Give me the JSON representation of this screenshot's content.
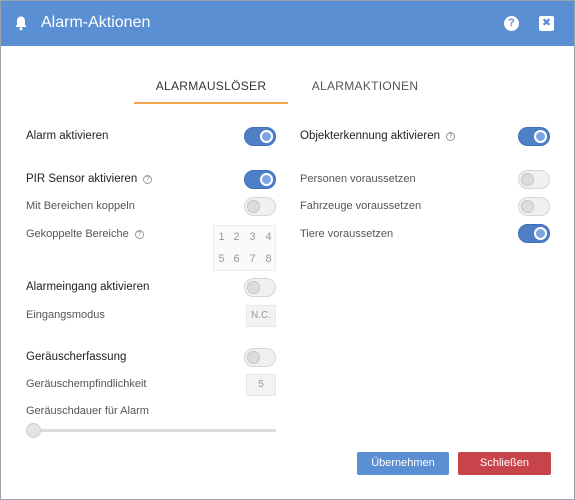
{
  "dialog": {
    "title": "Alarm-Aktionen",
    "icons": {
      "title": "bell-icon",
      "help": "help-icon",
      "close": "close-icon"
    },
    "help_glyph": "?",
    "close_glyph": "✖"
  },
  "tabs": [
    {
      "label": "ALARMAUSLÖSER",
      "active": true
    },
    {
      "label": "ALARMAKTIONEN",
      "active": false
    }
  ],
  "left": {
    "alarm_enable": {
      "label": "Alarm aktivieren",
      "on": true
    },
    "pir_enable": {
      "label": "PIR Sensor aktivieren",
      "on": true
    },
    "link_zones": {
      "label": "Mit Bereichen koppeln",
      "on": false
    },
    "linked_zones": {
      "label": "Gekoppelte Bereiche",
      "cells": [
        "1",
        "2",
        "3",
        "4",
        "5",
        "6",
        "7",
        "8"
      ]
    },
    "alarm_input": {
      "label": "Alarmeingang aktivieren",
      "on": false
    },
    "input_mode": {
      "label": "Eingangsmodus",
      "value": "N.C."
    },
    "noise_detect": {
      "label": "Geräuscherfassung",
      "on": false
    },
    "noise_sensitivity": {
      "label": "Geräuschempfindlichkeit",
      "value": "5"
    },
    "noise_duration": {
      "label": "Geräuschdauer für Alarm",
      "slider_fraction": 0
    }
  },
  "right": {
    "object_detect": {
      "label": "Objekterkennung aktivieren",
      "on": true
    },
    "persons": {
      "label": "Personen voraussetzen",
      "on": false
    },
    "vehicles": {
      "label": "Fahrzeuge voraussetzen",
      "on": false
    },
    "animals": {
      "label": "Tiere voraussetzen",
      "on": true
    }
  },
  "help_mark": "?",
  "buttons": {
    "apply": "Übernehmen",
    "close": "Schließen"
  },
  "colors": {
    "header": "#5b8fd3",
    "toggle_on": "#4e7fc7",
    "tab_underline": "#f0a44b",
    "apply": "#5b8fd3",
    "close": "#c8444b"
  }
}
